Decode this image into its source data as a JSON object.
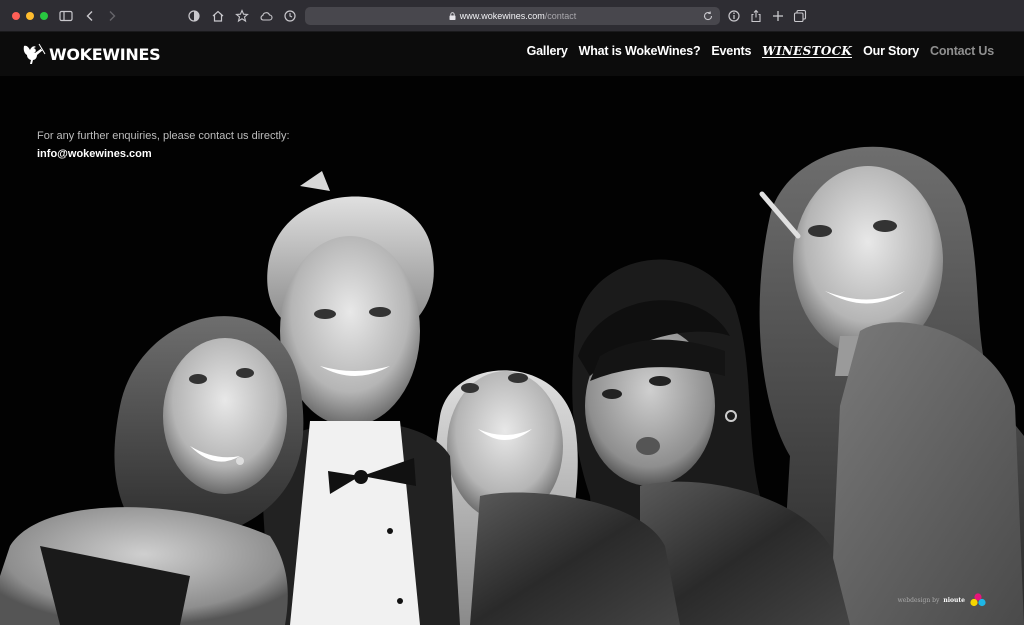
{
  "browser": {
    "url_domain": "www.wokewines.com",
    "url_path": "/contact"
  },
  "site": {
    "logo_text": "WOKEWINES",
    "nav": [
      {
        "label": "Gallery"
      },
      {
        "label": "What is WokeWines?"
      },
      {
        "label": "Events"
      },
      {
        "label": "WINESTOCK"
      },
      {
        "label": "Our Story"
      },
      {
        "label": "Contact Us"
      }
    ]
  },
  "contact": {
    "enquiry_text": "For any further enquiries, please contact us directly:",
    "email": "info@wokewines.com"
  },
  "footer": {
    "credit_prefix": "webdesign by",
    "credit_name": "nioute"
  },
  "colors": {
    "chrome_bg": "#2e2d33",
    "address_bg": "#48474d",
    "header_bg": "#0c0c0c",
    "active_nav": "#8f8f8f"
  }
}
